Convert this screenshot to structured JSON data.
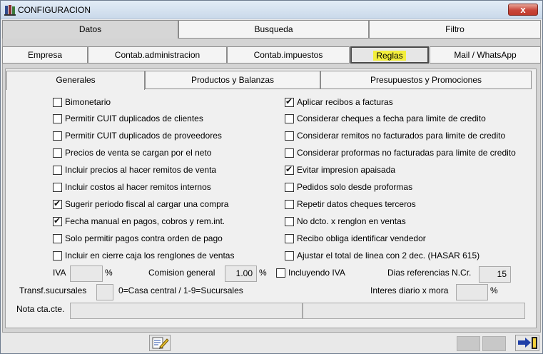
{
  "window": {
    "title": "CONFIGURACION",
    "close_label": "x"
  },
  "tabs_main": [
    {
      "label": "Datos",
      "active": true
    },
    {
      "label": "Busqueda",
      "active": false
    },
    {
      "label": "Filtro",
      "active": false
    }
  ],
  "tabs_sub": [
    {
      "label": "Empresa"
    },
    {
      "label": "Contab.administracion"
    },
    {
      "label": "Contab.impuestos"
    },
    {
      "label": "Reglas",
      "active": true
    },
    {
      "label": "Mail / WhatsApp"
    }
  ],
  "tabs_inner": [
    {
      "label": "Generales",
      "active": true
    },
    {
      "label": "Productos y Balanzas"
    },
    {
      "label": "Presupuestos y Promociones"
    }
  ],
  "left_options": [
    {
      "label": "Bimonetario",
      "checked": false
    },
    {
      "label": "Permitir CUIT duplicados de clientes",
      "checked": false
    },
    {
      "label": "Permitir CUIT duplicados de proveedores",
      "checked": false
    },
    {
      "label": "Precios de venta se cargan por el neto",
      "checked": false
    },
    {
      "label": "Incluir precios al hacer remitos de venta",
      "checked": false
    },
    {
      "label": "Incluir costos al hacer remitos internos",
      "checked": false
    },
    {
      "label": "Sugerir periodo fiscal al cargar una compra",
      "checked": true
    },
    {
      "label": "Fecha manual en pagos, cobros y rem.int.",
      "checked": true
    },
    {
      "label": "Solo permitir pagos contra orden de pago",
      "checked": false
    },
    {
      "label": "Incluir en cierre caja los renglones de ventas",
      "checked": false
    }
  ],
  "right_options": [
    {
      "label": "Aplicar recibos a facturas",
      "checked": true
    },
    {
      "label": "Considerar cheques a fecha para limite de credito",
      "checked": false
    },
    {
      "label": "Considerar remitos no facturados para limite de credito",
      "checked": false
    },
    {
      "label": "Considerar proformas no facturadas para limite de credito",
      "checked": false
    },
    {
      "label": "Evitar impresion apaisada",
      "checked": true
    },
    {
      "label": "Pedidos solo desde proformas",
      "checked": false
    },
    {
      "label": "Repetir datos cheques terceros",
      "checked": false
    },
    {
      "label": "No dcto. x renglon en ventas",
      "checked": false
    },
    {
      "label": "Recibo obliga identificar vendedor",
      "checked": false
    },
    {
      "label": "Ajustar el total de linea con 2 dec. (HASAR 615)",
      "checked": false
    }
  ],
  "fields": {
    "iva_label": "IVA",
    "iva_value": "",
    "iva_unit": "%",
    "comision_label": "Comision general",
    "comision_value": "1.00",
    "comision_unit": "%",
    "incluyendo_iva_label": "Incluyendo IVA",
    "incluyendo_iva_checked": false,
    "dias_label": "Dias referencias N.Cr.",
    "dias_value": "15",
    "transf_label": "Transf.sucursales",
    "transf_value": "",
    "transf_hint": "0=Casa central / 1-9=Sucursales",
    "interes_label": "Interes diario x mora",
    "interes_value": "",
    "interes_unit": "%",
    "nota_label": "Nota cta.cte.",
    "nota_value_1": "",
    "nota_value_2": ""
  },
  "colors": {
    "highlight": "#f3ee3c",
    "close": "#c9473a"
  },
  "icons": [
    "app-icon",
    "edit-config-icon",
    "exit-icon"
  ]
}
